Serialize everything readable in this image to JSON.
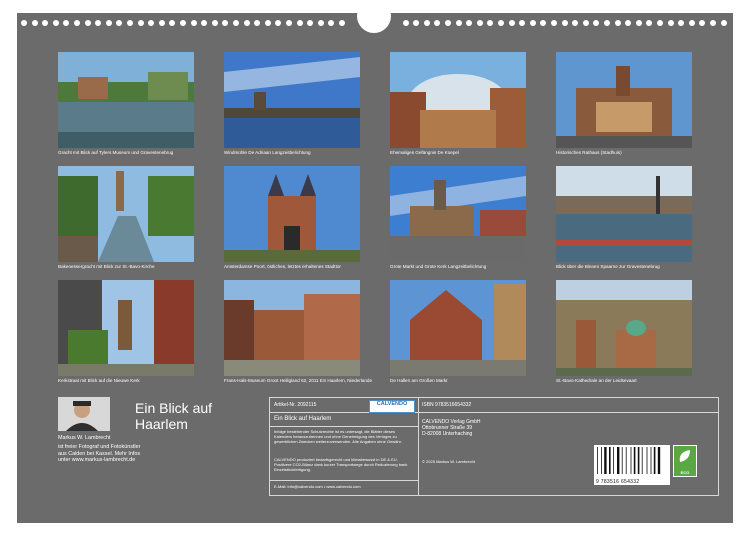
{
  "photos": [
    {
      "caption": "Gracht mit Blick auf Tylers Museum und Gravestenebrug"
    },
    {
      "caption": "Windmühle De Adriaan Langzeitbelichtung"
    },
    {
      "caption": "Ehemaliges Gefängnis De Koepel"
    },
    {
      "caption": "Historisches Rathaus (Stadhuis)"
    },
    {
      "caption": "Bakenessergracht mit Blick zur St.-Bavo-Kirche"
    },
    {
      "caption": "Amsterdamse Poort, östliches, letztes erhaltenes Stadttor"
    },
    {
      "caption": "Grote Markt und Grote Kerk Langzeitbelichtung"
    },
    {
      "caption": "Blick über die Binnen Spaarne zur Gravestenebrug"
    },
    {
      "caption": "Kerkstraat mit Blick auf die Nieuwe Kerk"
    },
    {
      "caption": "Frans-Hals-Museum Groot Heiligland 62, 2011 ES Haarlem, Niederlande"
    },
    {
      "caption": "De Hallen am Großen Markt"
    },
    {
      "caption": "St.-Bavo-Kathedrale an der Leidsevaart"
    }
  ],
  "title_line1": "Ein Blick auf",
  "title_line2": "Haarlem",
  "author": {
    "name": "Markus W. Lambrecht",
    "bio": "ist freier Fotograf und Fotokünstler aus Calden bei Kassel. Mehr Infos unter www.markus-lambrecht.de"
  },
  "info": {
    "article": "Artikel-Nr. 2092115",
    "logo": "CALVENDO",
    "title": "Ein Blick auf Haarlem",
    "legal": "Infolge bestehender Schutzrechte ist es untersagt, die Blätter dieses Kalenders herauszutrennen und ohne Genehmigung des Verlages zu gewerblichen Zwecken weiterzuverwenden. Alle Angaben ohne Gewähr.",
    "eco": "CALVENDO produziert bedarfsgerecht und klimabewusst in DE & EU. Positivere CO2-Bilanz dank kurzer Transportwege durch Reduzierung bank Einzelstückfertigung.",
    "contact": "E-Mail: info@calvendo.com • www.calvendo.com",
    "isbn": "ISBN 9783516654332",
    "publisher_lines": [
      "CALVENDO Verlag GmbH",
      "Ottobrunner Straße 39",
      "D-82008 Unterhaching"
    ],
    "copyright": "© 2025 Markus W. Lambrecht",
    "barcode_number": "9 783516 654332",
    "eco_label": "ECO"
  }
}
